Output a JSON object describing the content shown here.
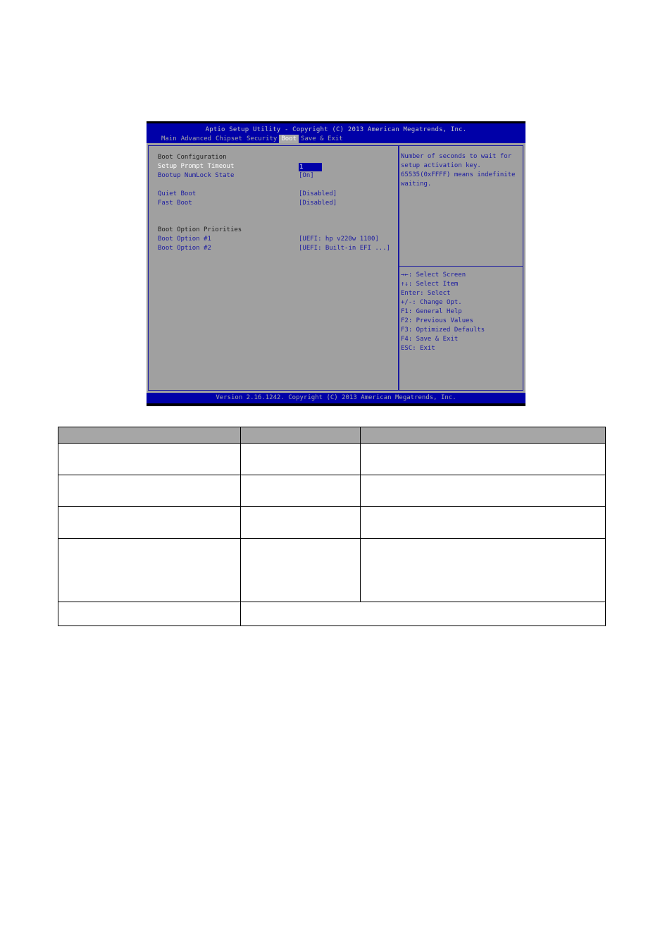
{
  "bios": {
    "title": "Aptio Setup Utility - Copyright (C) 2013 American Megatrends, Inc.",
    "tabs": [
      {
        "label": "Main",
        "active": false
      },
      {
        "label": "Advanced",
        "active": false
      },
      {
        "label": "Chipset",
        "active": false
      },
      {
        "label": "Security",
        "active": false
      },
      {
        "label": "Boot",
        "active": true
      },
      {
        "label": "Save & Exit",
        "active": false
      }
    ],
    "section_boot_configuration": "Boot Configuration",
    "items": [
      {
        "label": "Setup Prompt Timeout",
        "value": "1",
        "selected": true
      },
      {
        "label": "Bootup NumLock State",
        "value": "[On]"
      },
      {
        "label": "Quiet Boot",
        "value": "[Disabled]"
      },
      {
        "label": "Fast Boot",
        "value": "[Disabled]"
      }
    ],
    "section_boot_priorities": "Boot Option Priorities",
    "boot_options": [
      {
        "label": "Boot Option #1",
        "value": "[UEFI: hp v220w 1100]"
      },
      {
        "label": "Boot Option #2",
        "value": "[UEFI: Built-in EFI ...]"
      }
    ],
    "help_text": [
      "Number of seconds to wait for",
      "setup activation key.",
      "65535(0xFFFF) means indefinite",
      "waiting."
    ],
    "key_legend": [
      "→←: Select Screen",
      "↑↓: Select Item",
      "Enter: Select",
      "+/-: Change Opt.",
      "F1: General Help",
      "F2: Previous Values",
      "F3: Optimized Defaults",
      "F4: Save & Exit",
      "ESC: Exit"
    ],
    "footer": "Version 2.16.1242. Copyright (C) 2013 American Megatrends, Inc.",
    "colors": {
      "bar": "#0000a8",
      "body": "#a0a0a0",
      "text": "#1a1aa0"
    }
  },
  "table": {
    "header": [
      "",
      "",
      ""
    ],
    "rows": [
      [
        "",
        "",
        ""
      ],
      [
        "",
        "",
        ""
      ],
      [
        "",
        "",
        ""
      ],
      [
        "",
        "",
        ""
      ],
      [
        "",
        ""
      ]
    ]
  }
}
